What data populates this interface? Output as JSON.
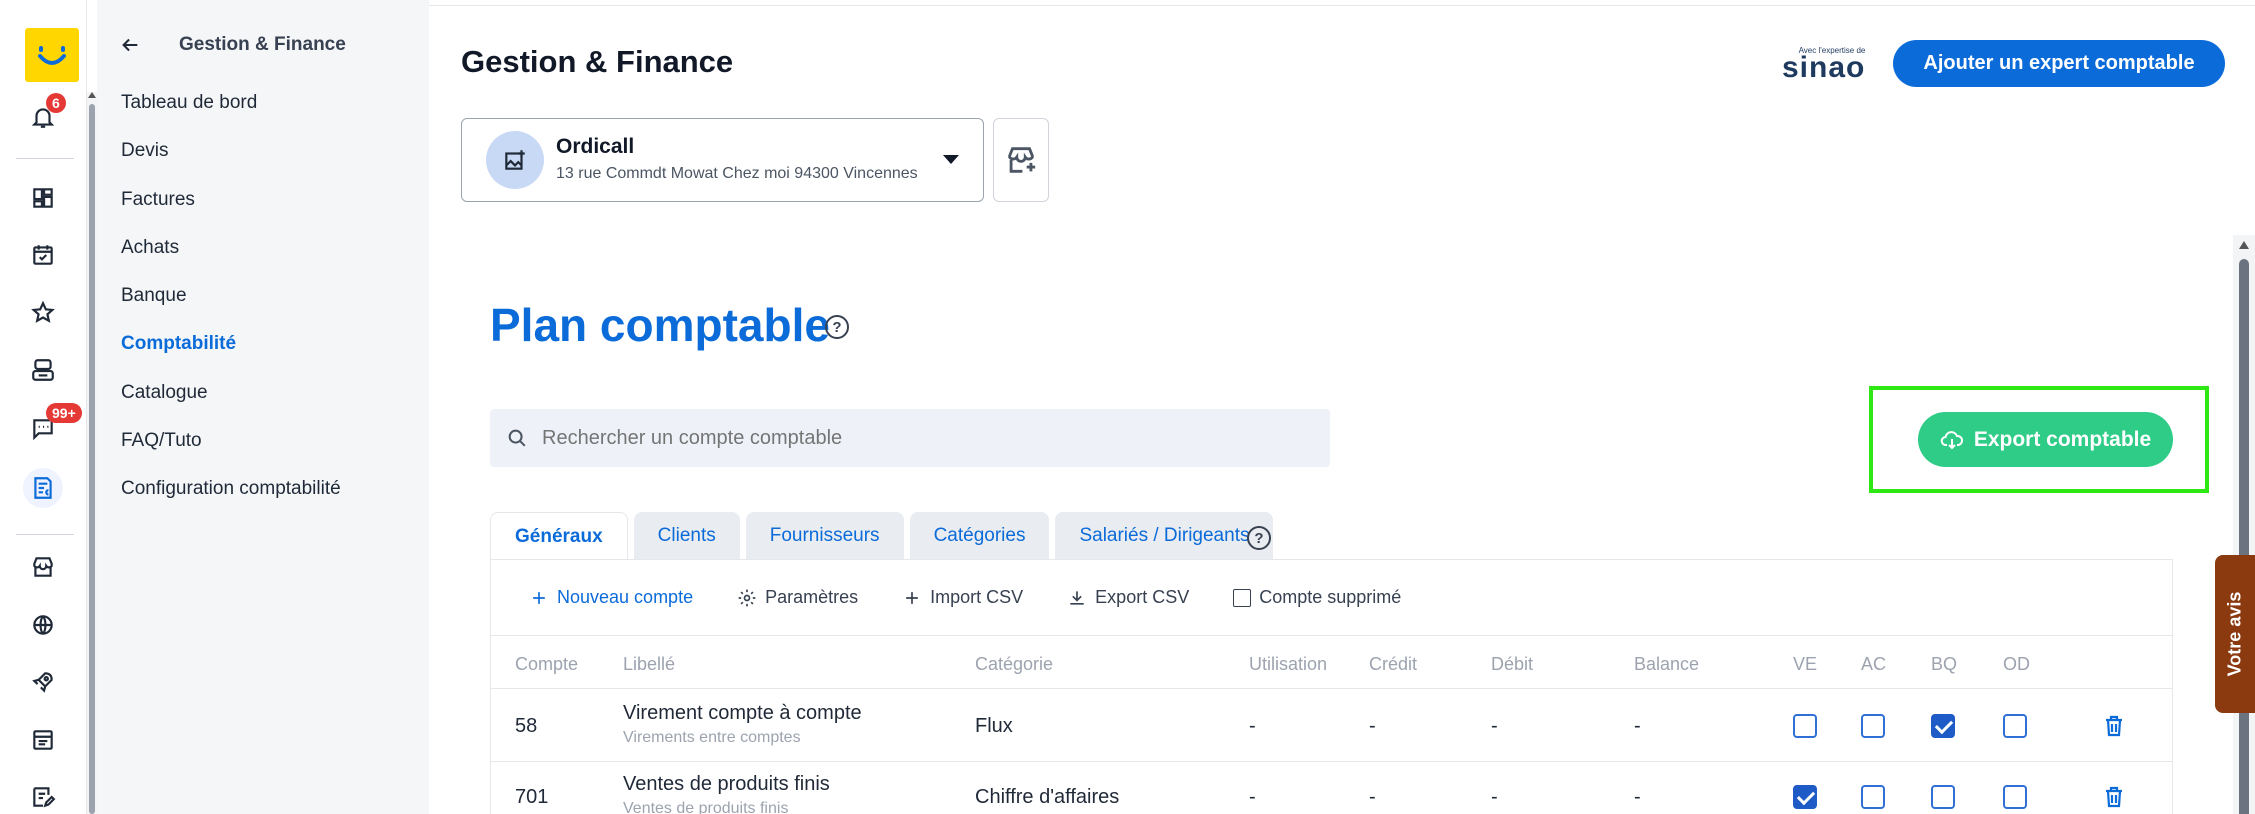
{
  "rail": {
    "notifications_badge": "6",
    "messages_badge": "99+",
    "icons": [
      "notifications-icon",
      "dashboard-icon",
      "calendar-icon",
      "star-icon",
      "contact-card-icon",
      "messages-icon",
      "finance-icon",
      "store-icon",
      "globe-icon",
      "rocket-icon",
      "browser-icon",
      "edit-list-icon"
    ]
  },
  "sidebar": {
    "title": "Gestion & Finance",
    "items": [
      {
        "label": "Tableau de bord"
      },
      {
        "label": "Devis"
      },
      {
        "label": "Factures"
      },
      {
        "label": "Achats"
      },
      {
        "label": "Banque"
      },
      {
        "label": "Comptabilité",
        "active": true
      },
      {
        "label": "Catalogue"
      },
      {
        "label": "FAQ/Tuto"
      },
      {
        "label": "Configuration comptabilité"
      }
    ]
  },
  "header": {
    "title": "Gestion & Finance",
    "sinao_small": "Avec l'expertise de",
    "sinao_big": "sinao",
    "expert_button": "Ajouter un expert comptable"
  },
  "company": {
    "name": "Ordicall",
    "address": "13 rue Commdt Mowat Chez moi 94300 Vincennes"
  },
  "section": {
    "title": "Plan comptable",
    "search_placeholder": "Rechercher un compte comptable",
    "export_button": "Export comptable"
  },
  "tabs": [
    {
      "label": "Généraux",
      "active": true
    },
    {
      "label": "Clients"
    },
    {
      "label": "Fournisseurs"
    },
    {
      "label": "Catégories"
    },
    {
      "label": "Salariés / Dirigeants"
    }
  ],
  "toolbar": {
    "new_account": "Nouveau compte",
    "settings": "Paramètres",
    "import_csv": "Import CSV",
    "export_csv": "Export CSV",
    "deleted_account": "Compte supprimé"
  },
  "table": {
    "columns": [
      "Compte",
      "Libellé",
      "Catégorie",
      "Utilisation",
      "Crédit",
      "Débit",
      "Balance",
      "VE",
      "AC",
      "BQ",
      "OD"
    ],
    "rows": [
      {
        "compte": "58",
        "libelle": "Virement compte à compte",
        "sous_libelle": "Virements entre comptes",
        "categorie": "Flux",
        "utilisation": "-",
        "credit": "-",
        "debit": "-",
        "balance": "-",
        "ve": false,
        "ac": false,
        "bq": true,
        "od": false
      },
      {
        "compte": "701",
        "libelle": "Ventes de produits finis",
        "sous_libelle": "Ventes de produits finis",
        "categorie": "Chiffre d'affaires",
        "utilisation": "-",
        "credit": "-",
        "debit": "-",
        "balance": "-",
        "ve": true,
        "ac": false,
        "bq": false,
        "od": false
      }
    ]
  },
  "feedback": {
    "label": "Votre avis"
  },
  "colors": {
    "accent": "#0b6bd9",
    "export_green": "#2ecc87",
    "highlight": "#2ee814",
    "badge": "#e53935"
  }
}
